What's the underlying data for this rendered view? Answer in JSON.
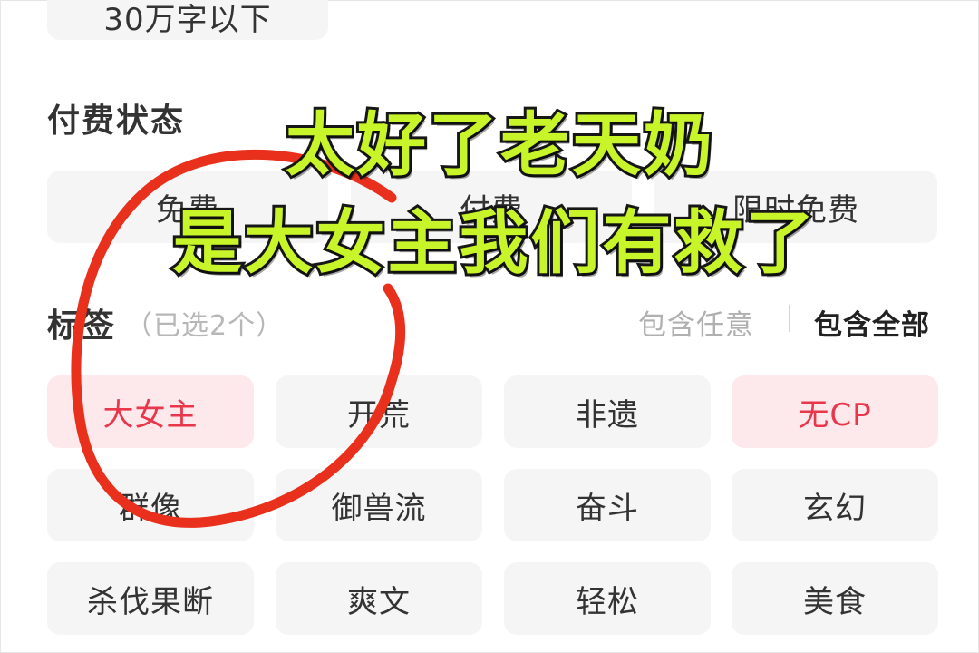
{
  "word_count": {
    "partial_option": "30万字以下"
  },
  "payment": {
    "title": "付费状态",
    "options": [
      "免费",
      "付费",
      "限时免费"
    ]
  },
  "tags": {
    "title": "标签",
    "selected_hint": "（已选2个）",
    "match_any": "包含任意",
    "match_all": "包含全部",
    "items": [
      {
        "label": "大女主",
        "selected": true
      },
      {
        "label": "开荒",
        "selected": false
      },
      {
        "label": "非遗",
        "selected": false
      },
      {
        "label": "无CP",
        "selected": true
      },
      {
        "label": "群像",
        "selected": false
      },
      {
        "label": "御兽流",
        "selected": false
      },
      {
        "label": "奋斗",
        "selected": false
      },
      {
        "label": "玄幻",
        "selected": false
      },
      {
        "label": "杀伐果断",
        "selected": false
      },
      {
        "label": "爽文",
        "selected": false
      },
      {
        "label": "轻松",
        "selected": false
      },
      {
        "label": "美食",
        "selected": false
      }
    ]
  },
  "overlay_caption": {
    "line1": "太好了老天奶",
    "line2": "是大女主我们有救了"
  },
  "colors": {
    "selected_chip_bg": "#fde9ec",
    "selected_chip_text": "#e8364a",
    "chip_bg": "#f5f5f6",
    "caption_fill": "#c8f52a",
    "caption_stroke": "#171717",
    "annotation_circle": "#e8301c"
  }
}
